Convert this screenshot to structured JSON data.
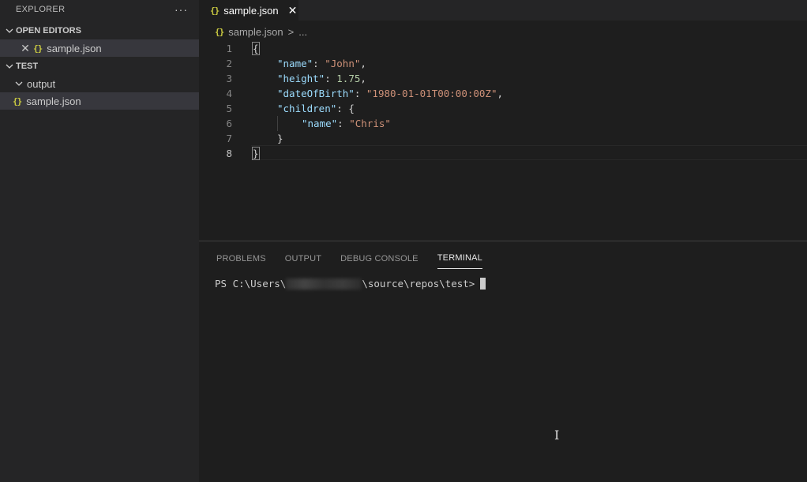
{
  "sidebar": {
    "title": "EXPLORER",
    "more": "···",
    "open_editors": {
      "title": "OPEN EDITORS",
      "items": [
        {
          "icon": "{}",
          "label": "sample.json"
        }
      ]
    },
    "folder": {
      "title": "TEST",
      "items": [
        {
          "label": "output",
          "type": "folder"
        },
        {
          "icon": "{}",
          "label": "sample.json",
          "type": "file"
        }
      ]
    }
  },
  "editor": {
    "tab": {
      "icon": "{}",
      "label": "sample.json"
    },
    "breadcrumb": {
      "icon": "{}",
      "file": "sample.json",
      "sep": ">",
      "more": "..."
    },
    "line_numbers": [
      "1",
      "2",
      "3",
      "4",
      "5",
      "6",
      "7",
      "8"
    ],
    "code": {
      "l1": "{",
      "l2_key": "\"name\"",
      "l2_val": "\"John\"",
      "l3_key": "\"height\"",
      "l3_val": "1.75",
      "l4_key": "\"dateOfBirth\"",
      "l4_val": "\"1980-01-01T00:00:00Z\"",
      "l5_key": "\"children\"",
      "l5_open": "{",
      "l6_key": "\"name\"",
      "l6_val": "\"Chris\"",
      "l7": "}",
      "l8": "}"
    }
  },
  "panel": {
    "tabs": [
      "PROBLEMS",
      "OUTPUT",
      "DEBUG CONSOLE",
      "TERMINAL"
    ],
    "active_tab": "TERMINAL",
    "prompt_prefix": "PS C:\\Users\\",
    "prompt_suffix": "\\source\\repos\\test>"
  },
  "colors": {
    "json_icon": "#cbcb41",
    "key": "#9cdcfe",
    "string": "#ce9178",
    "number": "#b5cea8"
  }
}
